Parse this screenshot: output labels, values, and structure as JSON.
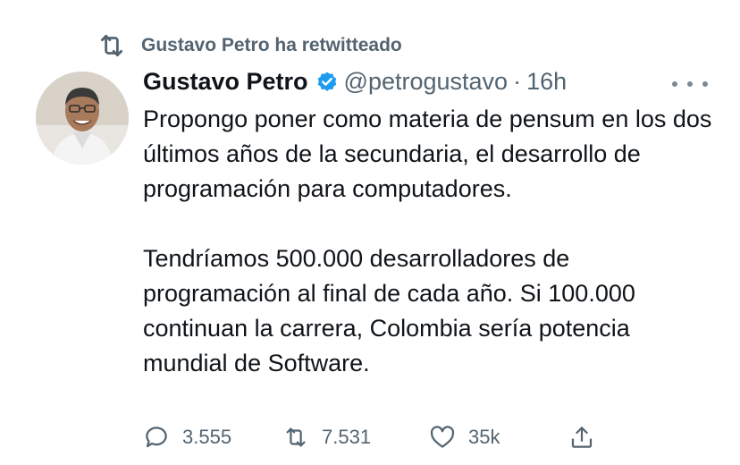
{
  "retweet_header": {
    "icon": "retweet-icon",
    "text": "Gustavo Petro ha retwitteado"
  },
  "tweet": {
    "author_name": "Gustavo Petro",
    "verified_icon": "verified-badge-icon",
    "handle": "@petrogustavo",
    "separator": "·",
    "time": "16h",
    "more_icon": "more-options-icon",
    "paragraph_1": "Propongo poner como materia de pensum en los dos últimos años de la secundaria, el desarrollo de programación para computadores.",
    "paragraph_2": "Tendríamos 500.000 desarrolladores de programación al final de cada año. Si 100.000 continuan la carrera, Colombia sería potencia mundial de Software."
  },
  "actions": {
    "reply": {
      "icon": "reply-icon",
      "count": "3.555"
    },
    "retweet": {
      "icon": "retweet-icon",
      "count": "7.531"
    },
    "like": {
      "icon": "heart-icon",
      "count": "35k"
    },
    "share": {
      "icon": "share-icon"
    }
  },
  "colors": {
    "text": "#0f1419",
    "secondary": "#536471",
    "verified": "#1d9bf0"
  }
}
